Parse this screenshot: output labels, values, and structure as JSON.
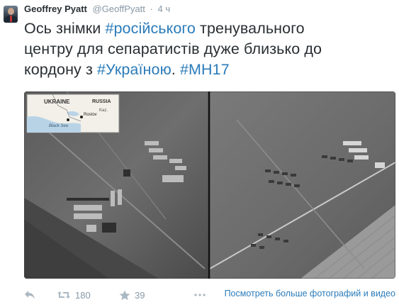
{
  "tweet": {
    "author_name": "Geoffrey Pyatt",
    "author_handle": "@GeoffPyatt",
    "separator": "·",
    "time": "4 ч",
    "text_line1_plain": "Ось знімки ",
    "text_line1_hashtag": "#російського",
    "text_line1_tail": " тренувального",
    "text_line2": "центру для сепаратистів дуже близько до",
    "text_line3_plain": "кордону з ",
    "text_line3_hashtag1": "#Україною",
    "text_line3_mid": ". ",
    "text_line3_hashtag2": "#MH17",
    "hashtag_color": "#2b7bb9"
  },
  "media": {
    "inset_map": {
      "label_ukraine": "UKRAINE",
      "label_russia": "RUSSIA",
      "label_rostov": "Rostov",
      "label_black_sea": "Black Sea",
      "label_kaz": "Kaz."
    }
  },
  "actions": {
    "reply_icon": "reply-icon",
    "retweet_icon": "retweet-icon",
    "retweet_count": "180",
    "favorite_icon": "star-icon",
    "favorite_count": "39",
    "more_link": "Посмотреть больше фотографий и видео"
  }
}
